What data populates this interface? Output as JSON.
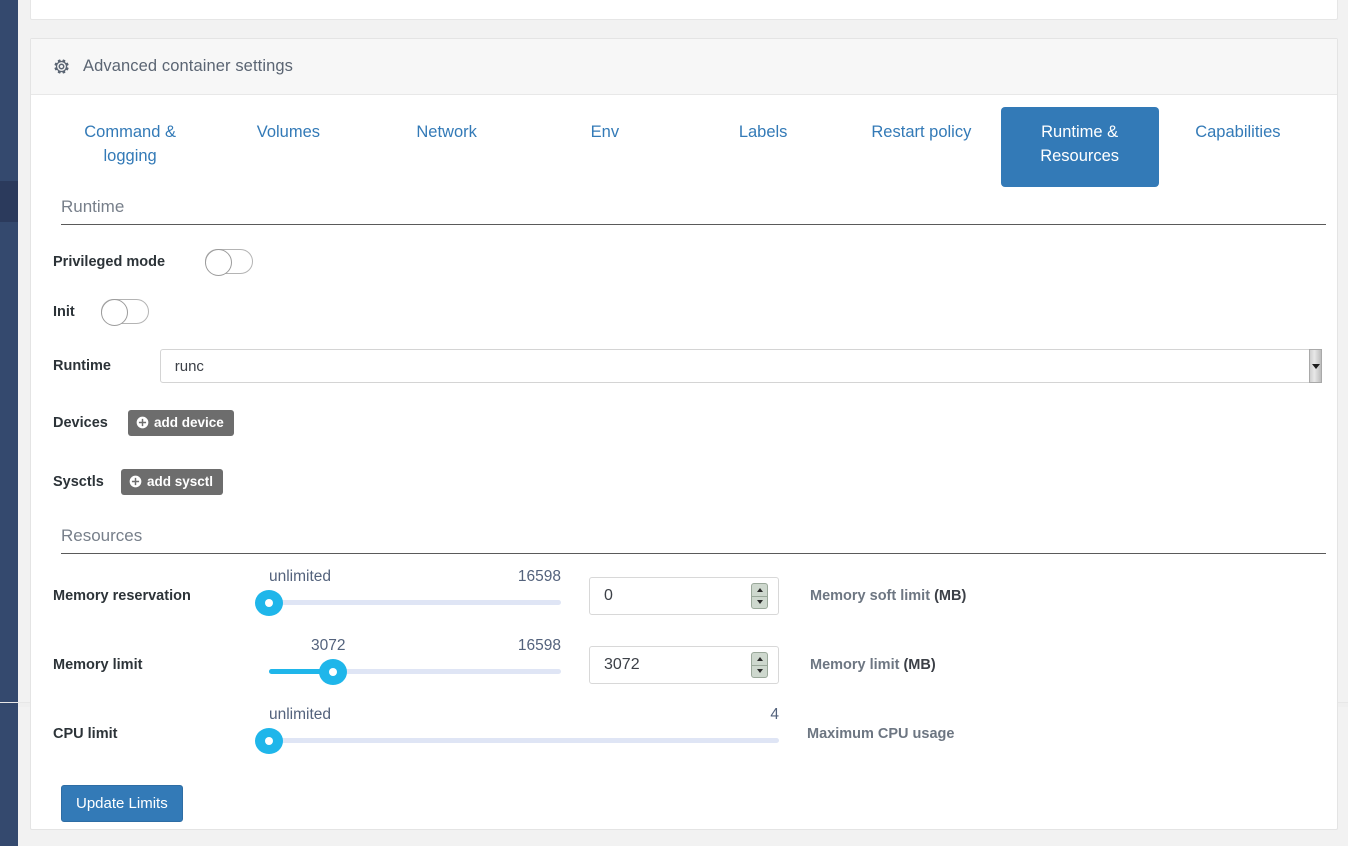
{
  "card": {
    "header_title": "Advanced container settings",
    "header_icon": "gear-icon"
  },
  "tabs": [
    {
      "label": "Command & logging",
      "active": false
    },
    {
      "label": "Volumes",
      "active": false
    },
    {
      "label": "Network",
      "active": false
    },
    {
      "label": "Env",
      "active": false
    },
    {
      "label": "Labels",
      "active": false
    },
    {
      "label": "Restart policy",
      "active": false
    },
    {
      "label": "Runtime & Resources",
      "active": true
    },
    {
      "label": "Capabilities",
      "active": false
    }
  ],
  "sections": {
    "runtime": {
      "title": "Runtime",
      "privileged_mode": {
        "label": "Privileged mode",
        "value": "off"
      },
      "init": {
        "label": "Init",
        "value": "off"
      },
      "runtime_select": {
        "label": "Runtime",
        "value": "runc"
      },
      "devices": {
        "label": "Devices",
        "button_label": "add device",
        "button_icon": "plus-circle-icon"
      },
      "sysctls": {
        "label": "Sysctls",
        "button_label": "add sysctl",
        "button_icon": "plus-circle-icon"
      }
    },
    "resources": {
      "title": "Resources",
      "memory_reservation": {
        "label": "Memory reservation",
        "min_label": "unlimited",
        "max_label": "16598",
        "handle_percent": 0,
        "input_value": "0",
        "description_text": "Memory soft limit ",
        "description_unit": "(MB)"
      },
      "memory_limit": {
        "label": "Memory limit",
        "min_label": "3072",
        "max_label": "16598",
        "handle_percent": 22,
        "input_value": "3072",
        "description_text": "Memory limit ",
        "description_unit": "(MB)"
      },
      "cpu_limit": {
        "label": "CPU limit",
        "min_label": "unlimited",
        "max_label": "4",
        "handle_percent": 0,
        "description_text": "Maximum CPU usage"
      }
    }
  },
  "actions": {
    "update_limits_label": "Update Limits"
  },
  "colors": {
    "accent_blue": "#337ab7",
    "slider_cyan": "#1fb6ea",
    "sidebar_navy": "#34496e",
    "gray_button": "#6d6d6d"
  }
}
